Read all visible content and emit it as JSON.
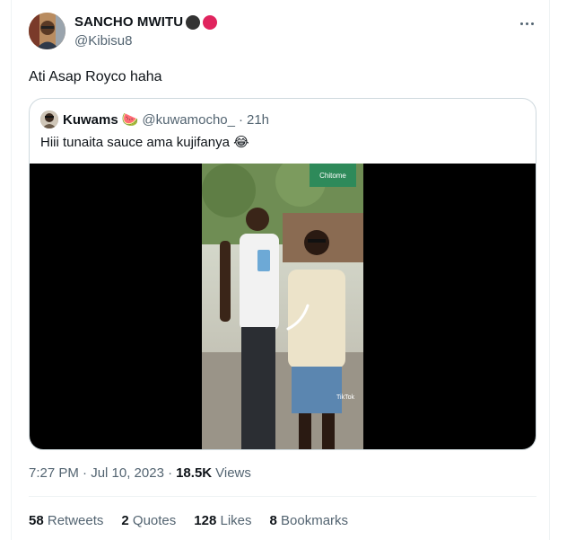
{
  "tweet": {
    "author": {
      "name": "SANCHO MWITU",
      "handle": "@Kibisu8",
      "badge_colors": [
        "#333333",
        "#e0245e"
      ]
    },
    "text": "Ati Asap Royco haha",
    "quote": {
      "author_name": "Kuwams",
      "author_emoji": "🍉",
      "handle": "@kuwamocho_",
      "separator": "·",
      "time": "21h",
      "text": "Hiii tunaita sauce ama kujifanya 😂",
      "video_watermark": "TikTok",
      "sign_text": "Chitome"
    },
    "timestamp": "7:27 PM · Jul 10, 2023 ·",
    "views_count": "18.5K",
    "views_label": "Views",
    "stats": [
      {
        "count": "58",
        "label": "Retweets"
      },
      {
        "count": "2",
        "label": "Quotes"
      },
      {
        "count": "128",
        "label": "Likes"
      },
      {
        "count": "8",
        "label": "Bookmarks"
      }
    ]
  }
}
